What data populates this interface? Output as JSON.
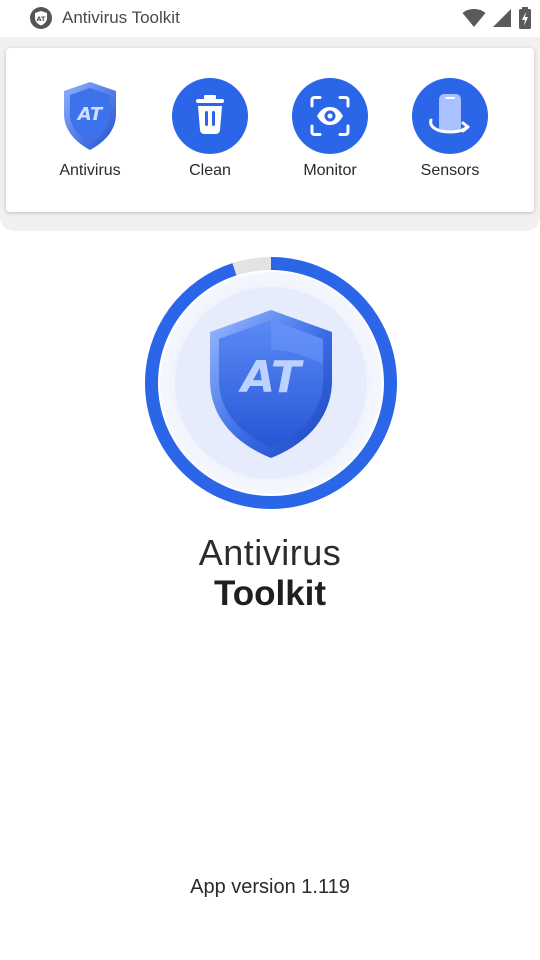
{
  "status_bar": {
    "app_name": "Antivirus Toolkit",
    "badge_text": "AT",
    "icons": [
      "wifi-icon",
      "signal-icon",
      "battery-icon"
    ]
  },
  "menu": {
    "items": [
      {
        "label": "Antivirus",
        "icon": "shield-icon"
      },
      {
        "label": "Clean",
        "icon": "trash-icon"
      },
      {
        "label": "Monitor",
        "icon": "eye-icon"
      },
      {
        "label": "Sensors",
        "icon": "phone-rotate-icon"
      }
    ]
  },
  "hero": {
    "shield_text": "AT",
    "progress_fraction": 0.95
  },
  "title": {
    "line1": "Antivirus",
    "line2": "Toolkit"
  },
  "footer": {
    "version": "App version 1.119"
  },
  "colors": {
    "accent": "#2b66e9",
    "ring_track": "#e3e3e3",
    "shield_light": "#7fa6ff",
    "shield_dark": "#1d4fd1"
  }
}
